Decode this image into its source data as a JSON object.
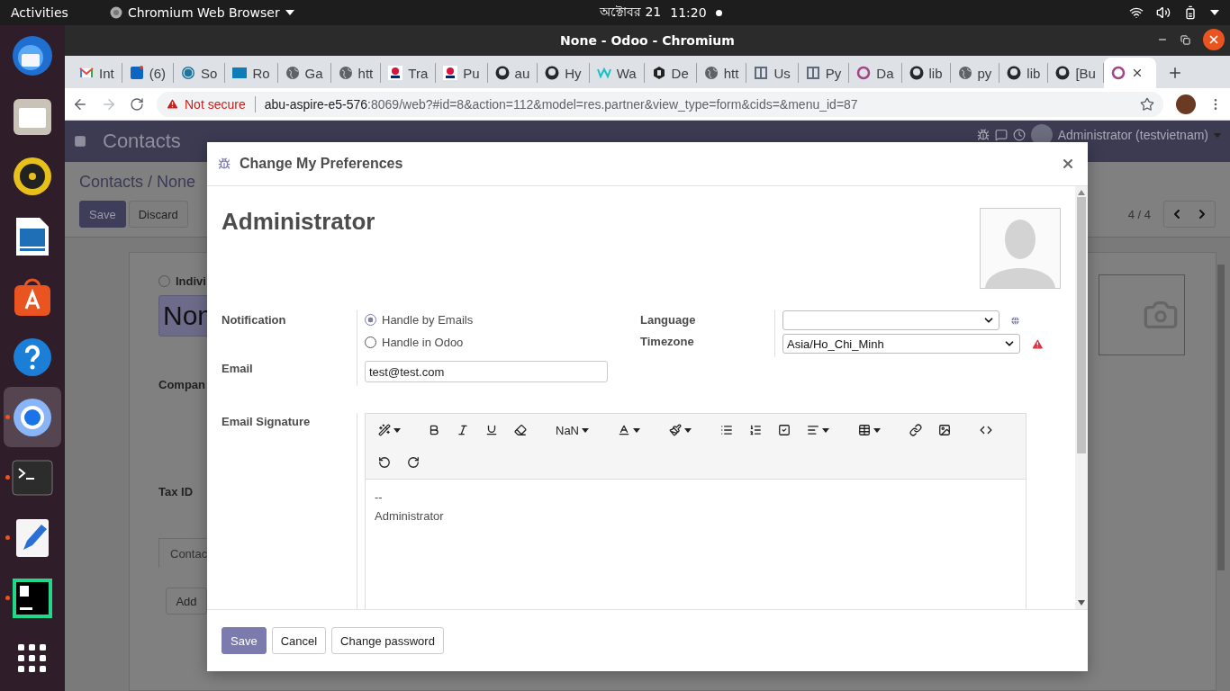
{
  "top_bar": {
    "activities": "Activities",
    "app_menu": "Chromium Web Browser",
    "date": "অক্টোবর 21",
    "time": "11:20"
  },
  "dock": [
    {
      "running": false,
      "selected": false
    },
    {
      "running": false,
      "selected": false
    },
    {
      "running": false,
      "selected": false
    },
    {
      "running": false,
      "selected": false
    },
    {
      "running": false,
      "selected": false
    },
    {
      "running": false,
      "selected": false
    },
    {
      "running": true,
      "selected": true
    },
    {
      "running": true,
      "selected": false
    },
    {
      "running": true,
      "selected": false
    },
    {
      "running": true,
      "selected": false
    },
    {
      "running": false,
      "selected": false
    }
  ],
  "window": {
    "title": "None - Odoo - Chromium"
  },
  "tabs": [
    {
      "label": "Int",
      "selected": false
    },
    {
      "label": "(6)",
      "selected": false
    },
    {
      "label": "So",
      "selected": false
    },
    {
      "label": "Ro",
      "selected": false
    },
    {
      "label": "Ga",
      "selected": false
    },
    {
      "label": "htt",
      "selected": false
    },
    {
      "label": "Tra",
      "selected": false
    },
    {
      "label": "Pu",
      "selected": false
    },
    {
      "label": "au",
      "selected": false
    },
    {
      "label": "Hy",
      "selected": false
    },
    {
      "label": "Wa",
      "selected": false
    },
    {
      "label": "De",
      "selected": false
    },
    {
      "label": "htt",
      "selected": false
    },
    {
      "label": "Us",
      "selected": false
    },
    {
      "label": "Py",
      "selected": false
    },
    {
      "label": "Da",
      "selected": false
    },
    {
      "label": "lib",
      "selected": false
    },
    {
      "label": "py",
      "selected": false
    },
    {
      "label": "lib",
      "selected": false
    },
    {
      "label": "[Bu",
      "selected": false
    },
    {
      "selected": true
    }
  ],
  "address_bar": {
    "security": "Not secure",
    "host": "abu-aspire-e5-576",
    "path": ":8069/web?#id=8&action=112&model=res.partner&view_type=form&cids=&menu_id=87"
  },
  "odoo": {
    "app": "Contacts",
    "user": "Administrator (testvietnam)",
    "breadcrumb": "Contacts / None",
    "buttons": [
      "Save",
      "Discard"
    ],
    "pager": "4 / 4",
    "form": {
      "type_label": "Indivi",
      "type_selected": false,
      "name": "Non",
      "labels": [
        "Compan",
        "Tax ID"
      ],
      "tab": "Contac",
      "add": "Add"
    }
  },
  "dialog": {
    "title": "Change My Preferences",
    "name": "Administrator",
    "notification": {
      "label": "Notification",
      "options": [
        {
          "label": "Handle by Emails",
          "selected": true
        },
        {
          "label": "Handle in Odoo",
          "selected": false
        }
      ]
    },
    "email": {
      "label": "Email",
      "value": "test@test.com"
    },
    "language": {
      "label": "Language"
    },
    "timezone": {
      "label": "Timezone",
      "value": "Asia/Ho_Chi_Minh",
      "warning": true
    },
    "signature": {
      "label": "Email Signature",
      "font_size": "NaN",
      "lines": [
        "--",
        "Administrator"
      ]
    },
    "buttons": [
      {
        "label": "Save",
        "primary": true
      },
      {
        "label": "Cancel",
        "primary": false
      },
      {
        "label": "Change password",
        "primary": false
      }
    ]
  }
}
